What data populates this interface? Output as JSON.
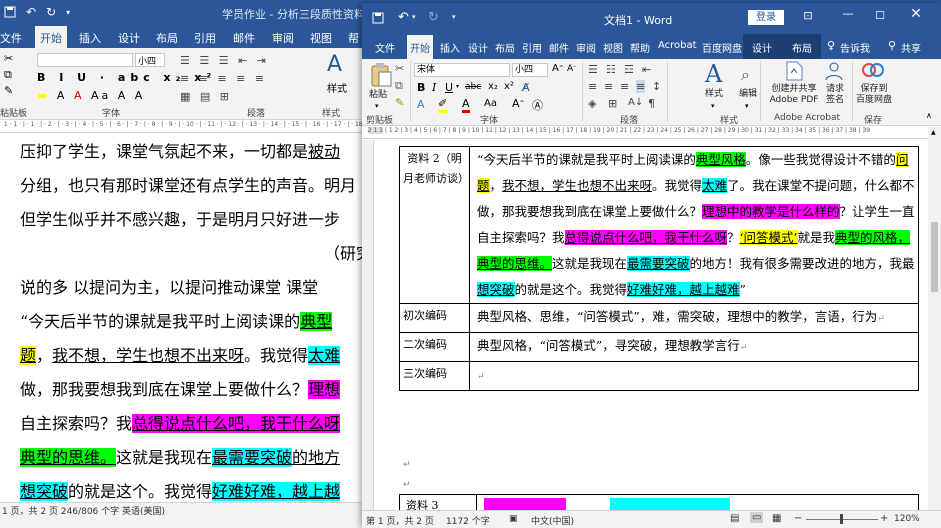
{
  "back_window": {
    "title": "学员作业 - 分析三段质性资料（zc",
    "tabs": [
      "文件",
      "开始",
      "插入",
      "设计",
      "布局",
      "引用",
      "邮件",
      "审阅",
      "视图",
      "帮"
    ],
    "ribbon": {
      "font_size": "小四",
      "group_labels": [
        "粘贴板",
        "字体",
        "段落",
        "样式",
        "样式"
      ]
    },
    "doc_lines": {
      "l1": [
        "压抑了学生，课堂气氛起不来，一切都是",
        "被动"
      ],
      "l2": "分组，也只有那时课堂还有点学生的声音。明月",
      "l3": "但学生似乎并不感兴趣，于是明月只好进一步",
      "l4": "（研究",
      "l5": "说的多  以提问为主，以提问推动课堂   课堂",
      "l6": [
        "“今天后半节的课就是我平时上阅读课的",
        "典型"
      ],
      "l7": [
        "题",
        "，",
        "我不想，学生也想不出来呀",
        "。我觉得",
        "太难"
      ],
      "l8": [
        "做，那我要想我到底在课堂上要做什么？",
        "理想"
      ],
      "l9": [
        "自主探索吗？我",
        "总得说点什么吧，我干什么呀"
      ],
      "l10": [
        "典型的思维。",
        "这就是我现在",
        "最需要突破",
        "的地方"
      ],
      "l11": [
        "想突破",
        "的就是这个。我觉得",
        "好难好难，越上越"
      ]
    },
    "status": "1 页，共 2 页    246/806 个字    英语(美国)"
  },
  "front_window": {
    "title": "文档1 - Word",
    "login": "登录",
    "tabs": [
      "文件",
      "开始",
      "插入",
      "设计",
      "布局",
      "引用",
      "邮件",
      "审阅",
      "视图",
      "帮助",
      "Acrobat",
      "百度网盘",
      "设计",
      "布局",
      "告诉我",
      "共享"
    ],
    "ribbon": {
      "font_name": "宋体",
      "font_size": "小四",
      "paste": "粘贴",
      "styles": "样式",
      "edit": "编辑",
      "acrobat": [
        "创建并共享",
        "Adobe PDF"
      ],
      "sign": [
        "请求",
        "签名"
      ],
      "save_baidu": [
        "保存到",
        "百度网盘"
      ],
      "group_labels": [
        "剪贴板",
        "字体",
        "段落",
        "样式",
        "Adobe Acrobat",
        "保存"
      ]
    },
    "table": {
      "row1": {
        "label": "资料 2（明月老师访谈）",
        "segments": [
          {
            "t": "“今天后半节的课就是我平时上阅读课的",
            "c": ""
          },
          {
            "t": "典型风格",
            "c": "hl-green ul"
          },
          {
            "t": "。像一些我觉得设计不错的",
            "c": ""
          },
          {
            "t": "问题",
            "c": "hl-yellow ul"
          },
          {
            "t": "，",
            "c": ""
          },
          {
            "t": "我不想，学生也想不出来呀",
            "c": "ul"
          },
          {
            "t": "。我觉得",
            "c": ""
          },
          {
            "t": "太难",
            "c": "hl-cyan ul"
          },
          {
            "t": "了。我在课堂不提问题，什么都不做，那我要想我到底在课堂上要做什么？",
            "c": ""
          },
          {
            "t": "理想中的教学是什么样的",
            "c": "hl-magenta"
          },
          {
            "t": "？让学生一直自主探索吗？我",
            "c": ""
          },
          {
            "t": "总得说点什么吧，我干什么呀",
            "c": "hl-magenta ul"
          },
          {
            "t": "？",
            "c": ""
          },
          {
            "t": "‘问答模式’",
            "c": "hl-yellow ul"
          },
          {
            "t": "就是我",
            "c": ""
          },
          {
            "t": "典型的风格，典型的思维。",
            "c": "hl-green ul"
          },
          {
            "t": "这就是我现在",
            "c": ""
          },
          {
            "t": "最需要突破",
            "c": "hl-cyan ul"
          },
          {
            "t": "的地方！我有很多需要改进的地方，我最",
            "c": ""
          },
          {
            "t": "想突破",
            "c": "hl-cyan ul"
          },
          {
            "t": "的就是这个。我觉得",
            "c": ""
          },
          {
            "t": "好难好难，越上越难",
            "c": "hl-cyan ul"
          },
          {
            "t": "”",
            "c": ""
          }
        ]
      },
      "row2": {
        "label": "初次编码",
        "text": "典型风格、思维，“问答模式”，难，需突破，理想中的教学，言语，行为"
      },
      "row3": {
        "label": "二次编码",
        "text": "典型风格，“问答模式”，寻突破，理想教学言行"
      },
      "row4": {
        "label": "三次编码",
        "text": ""
      },
      "next": "资料 3"
    },
    "status": {
      "page": "第 1 页，共 2 页",
      "words": "1172 个字",
      "lang": "中文(中国)",
      "zoom": "120%"
    }
  }
}
